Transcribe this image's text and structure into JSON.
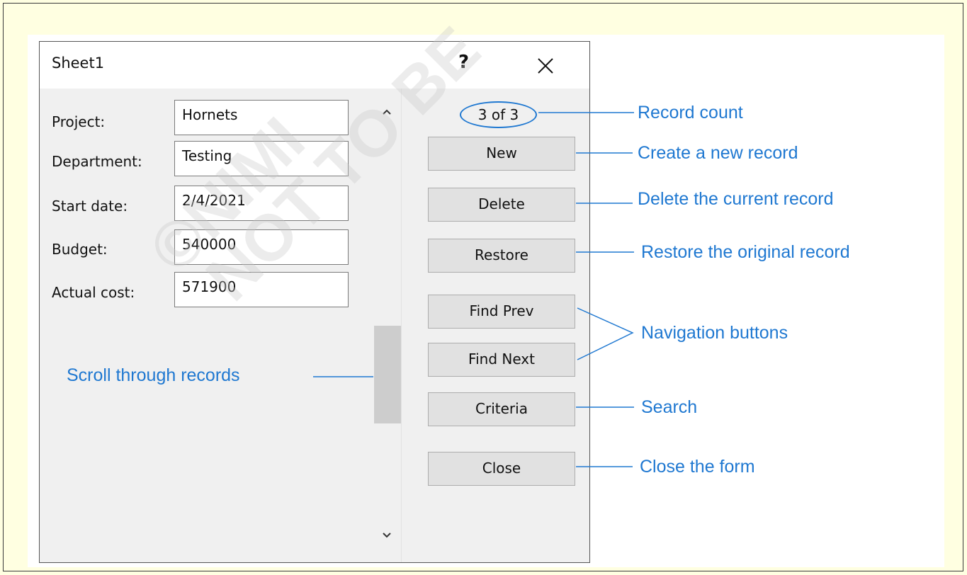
{
  "dialog": {
    "title": "Sheet1",
    "help": "?",
    "fields": [
      {
        "label": "Project:",
        "value": "Hornets"
      },
      {
        "label": "Department:",
        "value": "Testing"
      },
      {
        "label": "Start date:",
        "value": "2/4/2021"
      },
      {
        "label": "Budget:",
        "value": "540000"
      },
      {
        "label": "Actual cost:",
        "value": "571900"
      }
    ],
    "record_count": "3 of 3",
    "buttons": {
      "new": "New",
      "delete": "Delete",
      "restore": "Restore",
      "find_prev": "Find Prev",
      "find_next": "Find Next",
      "criteria": "Criteria",
      "close": "Close"
    }
  },
  "callouts": {
    "record_count": "Record count",
    "new": "Create a new record",
    "delete": "Delete the current record",
    "restore": "Restore the original record",
    "navigation": "Navigation buttons",
    "search": "Search",
    "close": "Close the form",
    "scroll": "Scroll through records"
  },
  "watermark": {
    "line1": "©NIMI",
    "line2": "NOT TO BE"
  },
  "colors": {
    "callout": "#1f78d1",
    "page_background": "#ffffe1"
  },
  "icons": {
    "close": "close-icon",
    "scroll_up": "chevron-up-icon",
    "scroll_down": "chevron-down-icon"
  }
}
